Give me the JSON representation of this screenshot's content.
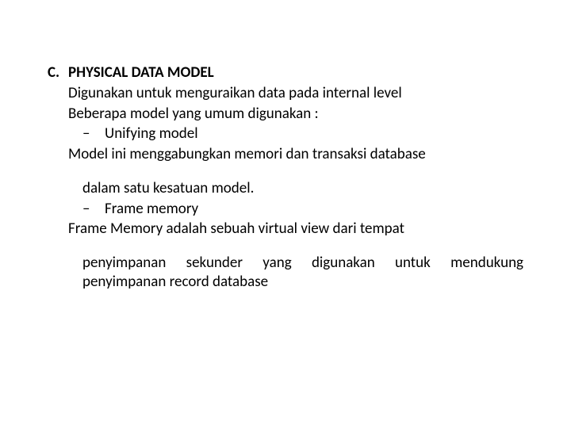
{
  "heading": {
    "letter": "C.",
    "title": "PHYSICAL DATA MODEL"
  },
  "intro1": "Digunakan untuk menguraikan data pada internal level",
  "intro2": "Beberapa model yang umum digunakan :",
  "bullets": {
    "dash": "–",
    "b1": "Unifying model",
    "b1desc_line1": "Model ini menggabungkan memori dan transaksi database",
    "b1desc_line2": "dalam satu kesatuan model.",
    "b2": "Frame memory",
    "b2desc_line1": "Frame Memory adalah sebuah virtual view dari tempat",
    "b2desc_line2": "penyimpanan sekunder yang digunakan untuk mendukung penyimpanan record database"
  }
}
